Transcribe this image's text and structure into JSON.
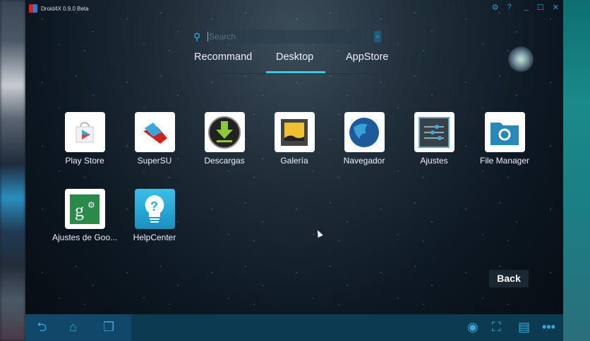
{
  "window": {
    "title": "Droid4X 0.9.0 Beta",
    "controls": [
      "settings",
      "help",
      "minimize",
      "maximize",
      "close"
    ]
  },
  "search": {
    "placeholder": "Search",
    "clear": "×"
  },
  "tabs": [
    {
      "label": "Recommand"
    },
    {
      "label": "Desktop",
      "active": true
    },
    {
      "label": "AppStore"
    }
  ],
  "apps": [
    {
      "label": "Play Store",
      "icon": "play-store-icon"
    },
    {
      "label": "SuperSU",
      "icon": "supersu-icon"
    },
    {
      "label": "Descargas",
      "icon": "downloads-icon"
    },
    {
      "label": "Galería",
      "icon": "gallery-icon"
    },
    {
      "label": "Navegador",
      "icon": "browser-icon"
    },
    {
      "label": "Ajustes",
      "icon": "settings-icon"
    },
    {
      "label": "File Manager",
      "icon": "file-manager-icon"
    },
    {
      "label": "Ajustes de Goo...",
      "icon": "google-settings-icon"
    },
    {
      "label": "HelpCenter",
      "icon": "help-center-icon"
    }
  ],
  "back_label": "Back",
  "navbar": {
    "left": [
      "back",
      "home",
      "recents"
    ],
    "right": [
      "camera",
      "fullscreen",
      "keyboard",
      "more"
    ]
  },
  "colors": {
    "accent": "#3cc8e0",
    "navbar": "#0c3a50"
  }
}
